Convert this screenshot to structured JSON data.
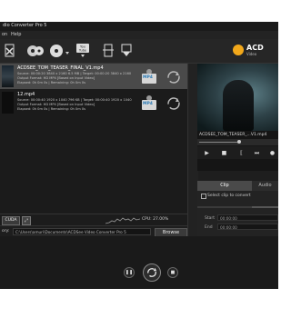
{
  "app": {
    "title": "dio Converter Pro 5"
  },
  "menu": {
    "items": [
      "on",
      "Help"
    ]
  },
  "toolbar": {
    "buttons": [
      "remove-file-icon",
      "add-disc-icon",
      "rip-disc-icon",
      "youtube-download-icon",
      "trim-icon",
      "download-icon"
    ],
    "youtube_label": "You Tube",
    "logo_text": "ACD",
    "logo_sub": "Video"
  },
  "files": [
    {
      "name": "ACDSEE_TOM_TEASER_FINAL_V1.mp4",
      "source_line": "Source: 00:00:20 3840 x 2160 6.5 MB | Target: 00:00:20 3840 x 2160",
      "format_line": "Output Format: HD MP4 [Based on Input Video]",
      "elapsed_line": "Elapsed: 0h 0m 0s | Remaining: 0h 0m 0s",
      "target_format": "MP4",
      "selected": true
    },
    {
      "name": "12.mp4",
      "source_line": "Source: 00:00:40 1920 x 1040 796 KB | Target: 00:00:40 1920 x 1040",
      "format_line": "Output Format: HD MP4 [Based on Input Video]",
      "elapsed_line": "Elapsed: 0h 0m 0s | Remaining: 0h 0m 0s",
      "target_format": "MP4",
      "selected": false
    }
  ],
  "status": {
    "cuda_label": "CUDA",
    "cpu_text": "CPU: 27.00%"
  },
  "output": {
    "label": "ory:",
    "path": "C:\\Users\\amuri\\Documents\\ACDSee Video Converter Pro 5",
    "browse_label": "Browse"
  },
  "preview": {
    "filename": "ACDSEE_TOM_TEASER_...V1.mp4"
  },
  "clip_panel": {
    "tab_active": "Clip",
    "tab_other": "Audio",
    "select_label": "Select clip to convert",
    "start_label": "Start",
    "end_label": "End",
    "start_value": "00:00:00",
    "end_value": "00:00:00"
  },
  "colors": {
    "accent": "#f2a81b",
    "selected_row": "#4a4a4a",
    "format_badge": "#2a7ab5"
  }
}
